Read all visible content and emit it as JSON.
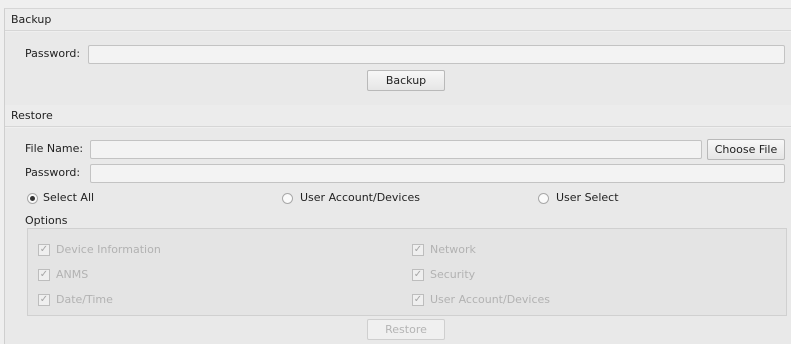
{
  "backup": {
    "title": "Backup",
    "password_label": "Password:",
    "password_value": "",
    "button_label": "Backup"
  },
  "restore": {
    "title": "Restore",
    "file_name_label": "File Name:",
    "file_name_value": "",
    "choose_file_label": "Choose File",
    "password_label": "Password:",
    "password_value": "",
    "radio_options": [
      {
        "label": "Select All",
        "selected": true
      },
      {
        "label": "User Account/Devices",
        "selected": false
      },
      {
        "label": "User Select",
        "selected": false
      }
    ],
    "options_title": "Options",
    "options": [
      {
        "label": "Device Information",
        "checked": true,
        "enabled": false
      },
      {
        "label": "Network",
        "checked": true,
        "enabled": false
      },
      {
        "label": "ANMS",
        "checked": true,
        "enabled": false
      },
      {
        "label": "Security",
        "checked": true,
        "enabled": false
      },
      {
        "label": "Date/Time",
        "checked": true,
        "enabled": false
      },
      {
        "label": "User Account/Devices",
        "checked": true,
        "enabled": false
      }
    ],
    "button_label": "Restore",
    "button_enabled": false
  }
}
